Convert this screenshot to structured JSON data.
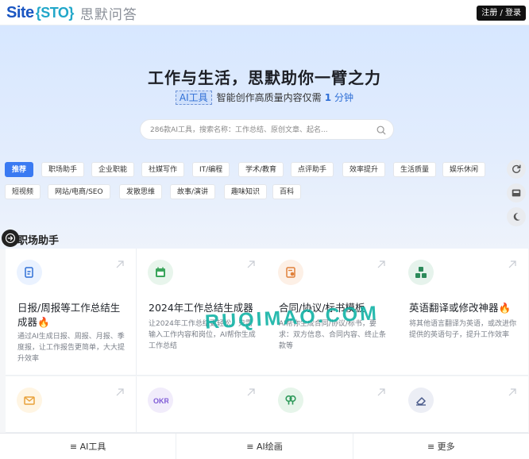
{
  "header": {
    "logo_site": "Site",
    "logo_sto": "{STO}",
    "logo_cn": "思默问答",
    "login": "注册 / 登录"
  },
  "hero": {
    "title": "工作与生活，思默助你一臂之力",
    "ai_tag": "AI工具",
    "subtitle_prefix": "智能创作高质量内容仅需",
    "subtitle_num": "1",
    "subtitle_suffix": "分钟",
    "search_placeholder": "286款AI工具，搜索名称：工作总结、原创文章、起名..."
  },
  "categories": [
    "推荐",
    "职场助手",
    "企业职能",
    "社媒写作",
    "IT/编程",
    "学术/教育",
    "点评助手",
    "效率提升",
    "生活质量",
    "娱乐休闲",
    "短视频",
    "网站/电商/SEO",
    "发散思维",
    "故事/演讲",
    "趣味知识",
    "百科"
  ],
  "section": {
    "title": "职场助手"
  },
  "cards": [
    {
      "title": "日报/周报等工作总结生成器",
      "desc": "通过AI生成日报、周报、月报、季度报，让工作报告更简单，大大提升效率",
      "icon": "document-pen-icon",
      "color": "#2f6fd6"
    },
    {
      "title": "2024年工作总结生成器",
      "desc": "让2024年工作总结更轻松，只需输入工作内容和岗位，AI帮你生成工作总结",
      "icon": "calendar-icon",
      "color": "#3aa55b"
    },
    {
      "title": "合同/协议/标书模板",
      "desc": "AI帮你生成合同/协议/标书，要求：双方信息、合同内容、终止条款等",
      "icon": "contract-icon",
      "color": "#e0803a"
    },
    {
      "title": "英语翻译或修改神器",
      "desc": "将其他语言翻译为英语，或改进你提供的英语句子，提升工作效率",
      "icon": "translate-icon",
      "color": "#2c8a5a"
    },
    {
      "title": "",
      "desc": "",
      "icon": "envelope-icon",
      "color": "#e9a23b"
    },
    {
      "title": "",
      "desc": "",
      "icon": "okr-icon",
      "color": "#7e5ad6"
    },
    {
      "title": "",
      "desc": "",
      "icon": "people-icon",
      "color": "#2f9a5b"
    },
    {
      "title": "",
      "desc": "",
      "icon": "eraser-icon",
      "color": "#4a5a8a"
    }
  ],
  "watermark": "RUQIMAO.COM",
  "bottom_bar": [
    "≡ AI工具",
    "≡ AI绘画",
    "≡ 更多"
  ]
}
